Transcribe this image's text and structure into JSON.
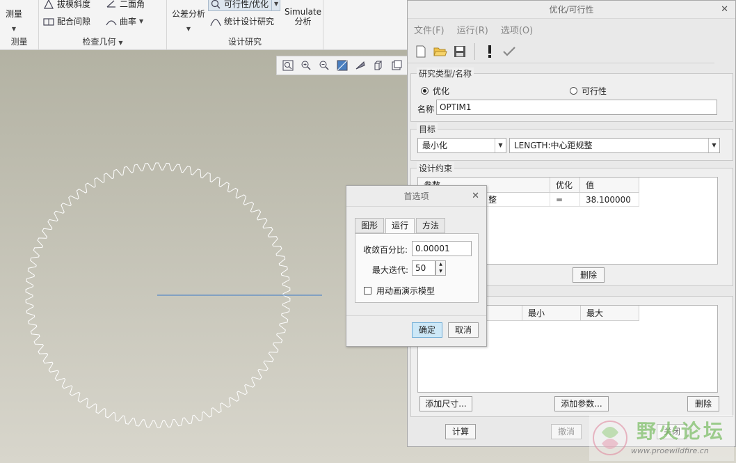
{
  "ribbon": {
    "measure": {
      "label": "测量",
      "group": "测量"
    },
    "inspect": {
      "draft": "拔模斜度",
      "clearance": "配合间隙",
      "dihedral": "二面角",
      "curvature": "曲率",
      "group": "检查几何"
    },
    "design": {
      "tolerance": "公差分析",
      "feasibility": "可行性/优化",
      "stat": "统计设计研究",
      "simulate_line1": "Simulate",
      "simulate_line2": "分析",
      "group": "设计研究"
    }
  },
  "main_dialog": {
    "title": "优化/可行性",
    "menu": [
      "文件(F)",
      "运行(R)",
      "选项(O)"
    ],
    "study_type": {
      "title": "研究类型/名称",
      "option_optimize": "优化",
      "option_feasibility": "可行性",
      "selected": "优化",
      "name_label": "名称",
      "name_value": "OPTIM1"
    },
    "goal": {
      "title": "目标",
      "mode": "最小化",
      "target": "LENGTH:中心距规整"
    },
    "constraints": {
      "title": "设计约束",
      "headers": [
        "参数",
        "优化",
        "值"
      ],
      "rows": [
        {
          "param": "整",
          "op": "=",
          "value": "38.100000"
        }
      ],
      "delete_button": "删除"
    },
    "variables": {
      "headers": [
        "最小",
        "最大"
      ],
      "add_dimension": "添加尺寸...",
      "add_param": "添加参数...",
      "delete_button": "删除"
    },
    "footer": {
      "compute": "计算",
      "undo": "撤消",
      "close": "关闭"
    }
  },
  "prefs_dialog": {
    "title": "首选项",
    "tabs": [
      "图形",
      "运行",
      "方法"
    ],
    "active_tab": "运行",
    "convergence_label": "收敛百分比:",
    "convergence_value": "0.00001",
    "max_iter_label": "最大迭代:",
    "max_iter_value": "50",
    "animate_label": "用动画演示模型",
    "animate_checked": false,
    "ok": "确定",
    "cancel": "取消"
  },
  "watermark": {
    "text": "野火论坛",
    "url": "www.proewildfire.cn"
  },
  "colors": {
    "accent_line": "#3a78c8",
    "ok_button": "#cde8f7",
    "ok_border": "#6aaad6"
  }
}
